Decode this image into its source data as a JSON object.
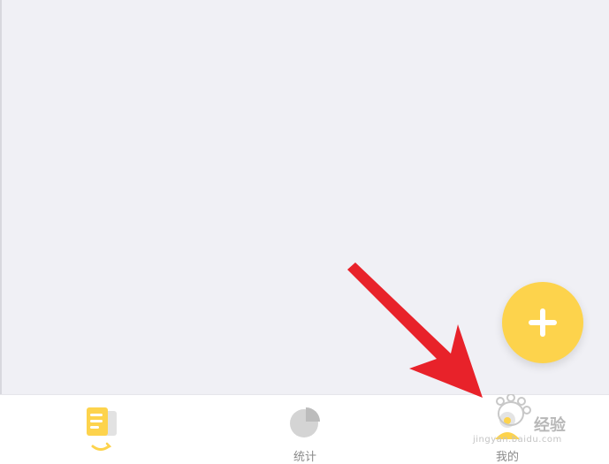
{
  "tabbar": {
    "tabs": [
      {
        "label": "",
        "icon": "bill-list-icon",
        "active": true
      },
      {
        "label": "统计",
        "icon": "pie-chart-icon",
        "active": false
      },
      {
        "label": "我的",
        "icon": "profile-icon",
        "active": false
      }
    ]
  },
  "fab": {
    "icon": "plus-icon"
  },
  "watermark": {
    "text": "经验",
    "sub": "jingyan.baidu.com"
  },
  "colors": {
    "accent": "#fdd34c",
    "background": "#f0f0f5",
    "tabbar": "#ffffff",
    "inactive_icon": "#cfcfcf",
    "inactive_label": "#8a8a8a",
    "annotation_arrow": "#e8222a"
  }
}
